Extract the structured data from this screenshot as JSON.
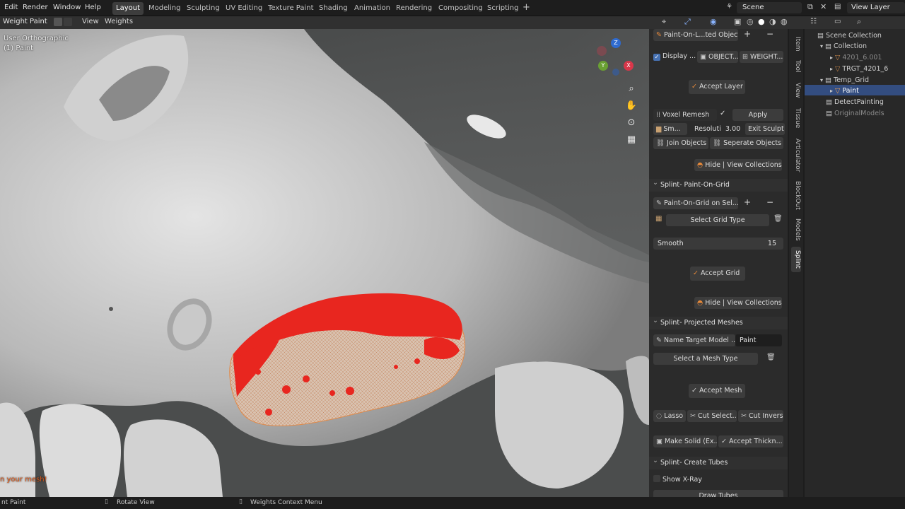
{
  "menu": [
    "Edit",
    "Render",
    "Window",
    "Help"
  ],
  "workspaces": [
    "Layout",
    "Modeling",
    "Sculpting",
    "UV Editing",
    "Texture Paint",
    "Shading",
    "Animation",
    "Rendering",
    "Compositing",
    "Scripting"
  ],
  "scene": "Scene",
  "view_layer": "View Layer",
  "header": {
    "mode": "Weight Paint",
    "view": "View",
    "weights": "Weights"
  },
  "viewport": {
    "line1": "User Orthographic",
    "line2": "(1) Paint",
    "warning": "n your mesh!"
  },
  "gizmo": {
    "z": "Z",
    "y": "Y",
    "x": "X"
  },
  "npanel": {
    "top_btn": "Paint-On-L...ted Object",
    "display": "Display ...",
    "object_btn": "OBJECT...",
    "weight_btn": "WEIGHT...",
    "accept_layer": "Accept Layer",
    "voxel_remesh": "Voxel Remesh",
    "apply": "Apply",
    "sm": "Sm...",
    "resolution_label": "Resoluti",
    "resolution_value": "3.00",
    "exit_sculpt": "Exit Sculpt",
    "join": "Join Objects",
    "separate": "Seperate Objects",
    "hide_view_1": "Hide | View Collections",
    "sec_grid": "Splint- Paint-On-Grid",
    "paint_grid": "Paint-On-Grid on Sel...",
    "select_grid": "Select Grid Type",
    "smooth_label": "Smooth",
    "smooth_value": "15",
    "accept_grid": "Accept Grid",
    "hide_view_2": "Hide | View Collections",
    "sec_proj": "Splint- Projected Meshes",
    "name_target": "Name Target Model ...",
    "name_value": "Paint",
    "select_mesh": "Select a Mesh Type",
    "accept_mesh": "Accept Mesh",
    "lasso": "Lasso",
    "cut_select": "Cut Select...",
    "cut_inverse": "Cut Inverse",
    "make_solid": "Make Solid (Ex...",
    "accept_thick": "Accept Thickn...",
    "sec_tubes": "Splint- Create Tubes",
    "show_xray": "Show X-Ray",
    "draw_tubes": "Draw Tubes"
  },
  "ntabs": [
    "Item",
    "Tool",
    "View",
    "Tissue",
    "Articulator",
    "BlockOut",
    "Models",
    "Splint"
  ],
  "outliner": {
    "scene_collection": "Scene Collection",
    "collection": "Collection",
    "obj1": "4201_6.001",
    "obj2": "TRGT_4201_6",
    "temp_grid": "Temp_Grid",
    "paint": "Paint",
    "detect": "DetectPainting",
    "original": "OriginalModels"
  },
  "status": {
    "s1": "nt Paint",
    "s2": "Rotate View",
    "s3": "Weights Context Menu"
  },
  "colors": {
    "paint_red": "#e8261f",
    "mesh": "#c8c8c8",
    "accent": "#4772b3"
  }
}
